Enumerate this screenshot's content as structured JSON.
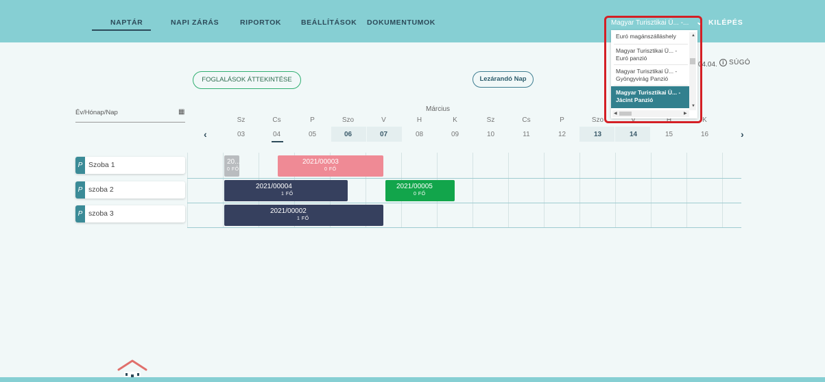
{
  "nav": {
    "items": [
      "NAPTÁR",
      "NAPI ZÁRÁS",
      "RIPORTOK",
      "BEÁLLÍTÁSOK",
      "DOKUMENTUMOK"
    ],
    "property_selected": "Magyar Turisztikai Ü... -...",
    "logout": "KILÉPÉS"
  },
  "dropdown": {
    "options": [
      "Euró magánszálláshely",
      "Magyar Turisztikai Ü... - Euró panzió",
      "Magyar Turisztikai Ü... - Gyöngyvirág Panzió",
      "Magyar Turisztikai Ü... - Jácint Panzió"
    ],
    "selected_index": 3
  },
  "header": {
    "date_fragment": "04.04.",
    "help": "SÚGÓ",
    "overview_button": "FOGLALÁSOK ÁTTEKINTÉSE",
    "close_day_button": "Lezárandó Nap",
    "date_placeholder": "Év/Hónap/Nap",
    "month": "Március"
  },
  "calendar": {
    "days": [
      {
        "name": "Sz",
        "num": "03"
      },
      {
        "name": "Cs",
        "num": "04"
      },
      {
        "name": "P",
        "num": "05"
      },
      {
        "name": "Szo",
        "num": "06"
      },
      {
        "name": "V",
        "num": "07"
      },
      {
        "name": "H",
        "num": "08"
      },
      {
        "name": "K",
        "num": "09"
      },
      {
        "name": "Sz",
        "num": "10"
      },
      {
        "name": "Cs",
        "num": "11"
      },
      {
        "name": "P",
        "num": "12"
      },
      {
        "name": "Szo",
        "num": "13"
      },
      {
        "name": "V",
        "num": "14"
      },
      {
        "name": "H",
        "num": "15"
      },
      {
        "name": "K",
        "num": "16"
      }
    ],
    "rooms": [
      "Szoba 1",
      "szoba 2",
      "szoba 3"
    ],
    "bookings": [
      {
        "id": "20...",
        "guests": "0 FŐ",
        "color": "#b9bcbf"
      },
      {
        "id": "2021/00003",
        "guests": "0 FŐ",
        "color": "#ef8a95"
      },
      {
        "id": "2021/00004",
        "guests": "1 FŐ",
        "color": "#36405e"
      },
      {
        "id": "2021/00005",
        "guests": "0 FŐ",
        "color": "#12a54b"
      },
      {
        "id": "2021/00002",
        "guests": "1 FŐ",
        "color": "#36405e"
      }
    ]
  },
  "colors": {
    "topbar": "#86cfd3",
    "nav_text": "#2c4a59",
    "highlight": "#d41f25",
    "selected_option": "#32808e"
  }
}
